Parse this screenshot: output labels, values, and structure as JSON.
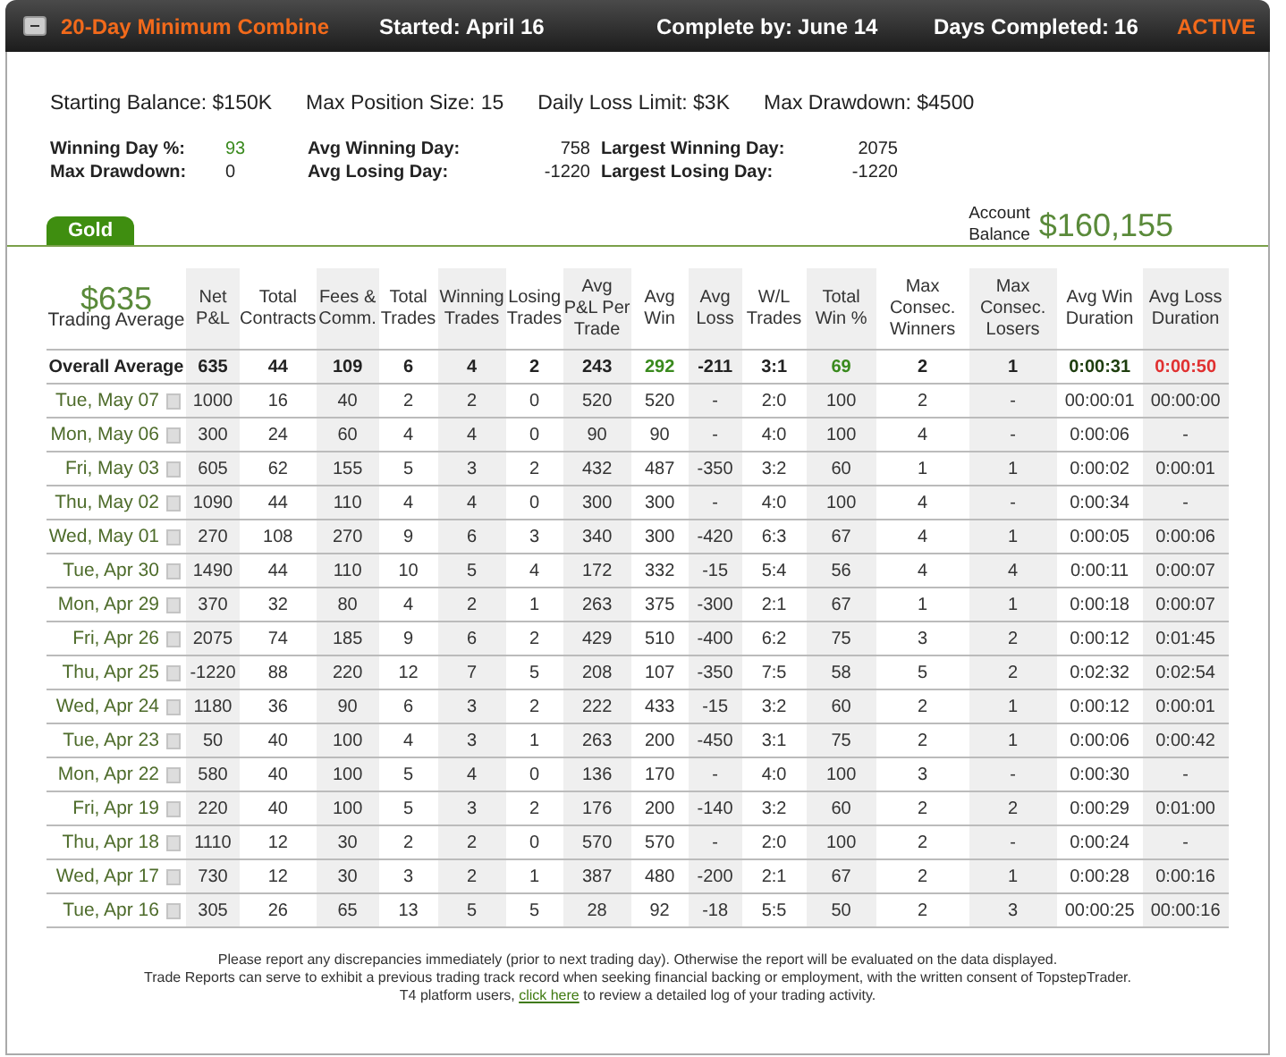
{
  "header": {
    "title": "20-Day Minimum Combine",
    "fields": [
      {
        "label": "Started:",
        "value": "April 16"
      },
      {
        "label": "Complete by:",
        "value": "June 14"
      },
      {
        "label": "Days Completed:",
        "value": "16"
      }
    ],
    "status": "ACTIVE"
  },
  "limits": [
    {
      "label": "Starting Balance:",
      "value": "$150K"
    },
    {
      "label": "Max Position Size:",
      "value": "15"
    },
    {
      "label": "Daily Loss Limit:",
      "value": "$3K"
    },
    {
      "label": "Max Drawdown:",
      "value": "$4500"
    }
  ],
  "stats": [
    {
      "label": "Winning Day %:",
      "value": "93",
      "color": "#3a8a1e"
    },
    {
      "label": "Avg Winning Day:",
      "value": "758",
      "color": "#222222"
    },
    {
      "label": "Largest Winning Day:",
      "value": "2075",
      "color": "#222222"
    },
    {
      "label": "Max Drawdown:",
      "value": "0",
      "color": "#222222"
    },
    {
      "label": "Avg Losing Day:",
      "value": "-1220",
      "color": "#222222"
    },
    {
      "label": "Largest Losing Day:",
      "value": "-1220",
      "color": "#222222"
    }
  ],
  "tabs": [
    {
      "label": "Gold",
      "selected": true
    }
  ],
  "account_balance": {
    "label_line1": "Account",
    "label_line2": "Balance",
    "value": "$160,155"
  },
  "table": {
    "trading_average": {
      "value": "$635",
      "label": "Trading Average"
    },
    "columns": [
      "Net P&L",
      "Total Contracts",
      "Fees & Comm.",
      "Total Trades",
      "Winning Trades",
      "Losing Trades",
      "Avg P&L Per Trade",
      "Avg Win",
      "Avg Loss",
      "W/L Trades",
      "Total Win %",
      "Max Consec. Winners",
      "Max Consec. Losers",
      "Avg Win Duration",
      "Avg Loss Duration"
    ],
    "overall": {
      "label": "Overall Average",
      "cells": [
        {
          "text": "635",
          "color": "#222222"
        },
        {
          "text": "44",
          "color": "#222222"
        },
        {
          "text": "109",
          "color": "#222222"
        },
        {
          "text": "6",
          "color": "#222222"
        },
        {
          "text": "4",
          "color": "#222222"
        },
        {
          "text": "2",
          "color": "#222222"
        },
        {
          "text": "243",
          "color": "#222222"
        },
        {
          "text": "292",
          "color": "#3a8a1e"
        },
        {
          "text": "-211",
          "color": "#222222"
        },
        {
          "text": "3:1",
          "color": "#222222"
        },
        {
          "text": "69",
          "color": "#3a8a1e"
        },
        {
          "text": "2",
          "color": "#222222"
        },
        {
          "text": "1",
          "color": "#222222"
        },
        {
          "text": "0:00:31",
          "color": "#1d3d0d"
        },
        {
          "text": "0:00:50",
          "color": "#e03030"
        }
      ]
    },
    "rows": [
      {
        "date": "Tue, May 07",
        "values": [
          "1000",
          "16",
          "40",
          "2",
          "2",
          "0",
          "520",
          "520",
          "-",
          "2:0",
          "100",
          "2",
          "-",
          "00:00:01",
          "00:00:00"
        ]
      },
      {
        "date": "Mon, May 06",
        "values": [
          "300",
          "24",
          "60",
          "4",
          "4",
          "0",
          "90",
          "90",
          "-",
          "4:0",
          "100",
          "4",
          "-",
          "0:00:06",
          "-"
        ]
      },
      {
        "date": "Fri, May 03",
        "values": [
          "605",
          "62",
          "155",
          "5",
          "3",
          "2",
          "432",
          "487",
          "-350",
          "3:2",
          "60",
          "1",
          "1",
          "0:00:02",
          "0:00:01"
        ]
      },
      {
        "date": "Thu, May 02",
        "values": [
          "1090",
          "44",
          "110",
          "4",
          "4",
          "0",
          "300",
          "300",
          "-",
          "4:0",
          "100",
          "4",
          "-",
          "0:00:34",
          "-"
        ]
      },
      {
        "date": "Wed, May 01",
        "values": [
          "270",
          "108",
          "270",
          "9",
          "6",
          "3",
          "340",
          "300",
          "-420",
          "6:3",
          "67",
          "4",
          "1",
          "0:00:05",
          "0:00:06"
        ]
      },
      {
        "date": "Tue, Apr 30",
        "values": [
          "1490",
          "44",
          "110",
          "10",
          "5",
          "4",
          "172",
          "332",
          "-15",
          "5:4",
          "56",
          "4",
          "4",
          "0:00:11",
          "0:00:07"
        ]
      },
      {
        "date": "Mon, Apr 29",
        "values": [
          "370",
          "32",
          "80",
          "4",
          "2",
          "1",
          "263",
          "375",
          "-300",
          "2:1",
          "67",
          "1",
          "1",
          "0:00:18",
          "0:00:07"
        ]
      },
      {
        "date": "Fri, Apr 26",
        "values": [
          "2075",
          "74",
          "185",
          "9",
          "6",
          "2",
          "429",
          "510",
          "-400",
          "6:2",
          "75",
          "3",
          "2",
          "0:00:12",
          "0:01:45"
        ]
      },
      {
        "date": "Thu, Apr 25",
        "values": [
          "-1220",
          "88",
          "220",
          "12",
          "7",
          "5",
          "208",
          "107",
          "-350",
          "7:5",
          "58",
          "5",
          "2",
          "0:02:32",
          "0:02:54"
        ]
      },
      {
        "date": "Wed, Apr 24",
        "values": [
          "1180",
          "36",
          "90",
          "6",
          "3",
          "2",
          "222",
          "433",
          "-15",
          "3:2",
          "60",
          "2",
          "1",
          "0:00:12",
          "0:00:01"
        ]
      },
      {
        "date": "Tue, Apr 23",
        "values": [
          "50",
          "40",
          "100",
          "4",
          "3",
          "1",
          "263",
          "200",
          "-450",
          "3:1",
          "75",
          "2",
          "1",
          "0:00:06",
          "0:00:42"
        ]
      },
      {
        "date": "Mon, Apr 22",
        "values": [
          "580",
          "40",
          "100",
          "5",
          "4",
          "0",
          "136",
          "170",
          "-",
          "4:0",
          "100",
          "3",
          "-",
          "0:00:30",
          "-"
        ]
      },
      {
        "date": "Fri, Apr 19",
        "values": [
          "220",
          "40",
          "100",
          "5",
          "3",
          "2",
          "176",
          "200",
          "-140",
          "3:2",
          "60",
          "2",
          "2",
          "0:00:29",
          "0:01:00"
        ]
      },
      {
        "date": "Thu, Apr 18",
        "values": [
          "1110",
          "12",
          "30",
          "2",
          "2",
          "0",
          "570",
          "570",
          "-",
          "2:0",
          "100",
          "2",
          "-",
          "0:00:24",
          "-"
        ]
      },
      {
        "date": "Wed, Apr 17",
        "values": [
          "730",
          "12",
          "30",
          "3",
          "2",
          "1",
          "387",
          "480",
          "-200",
          "2:1",
          "67",
          "2",
          "1",
          "0:00:28",
          "0:00:16"
        ]
      },
      {
        "date": "Tue, Apr 16",
        "values": [
          "305",
          "26",
          "65",
          "13",
          "5",
          "5",
          "28",
          "92",
          "-18",
          "5:5",
          "50",
          "2",
          "3",
          "00:00:25",
          "00:00:16"
        ]
      }
    ]
  },
  "footer": {
    "lines": [
      "Please report any discrepancies immediately (prior to next trading day). Otherwise the report will be evaluated on the data displayed.",
      "Trade Reports can serve to exhibit a previous trading track record when seeking financial backing or employment, with the written consent of TopstepTrader."
    ],
    "last_line": {
      "before": "T4 platform users,",
      "link": "click here",
      "after": "to review a detailed log of your trading activity."
    }
  }
}
